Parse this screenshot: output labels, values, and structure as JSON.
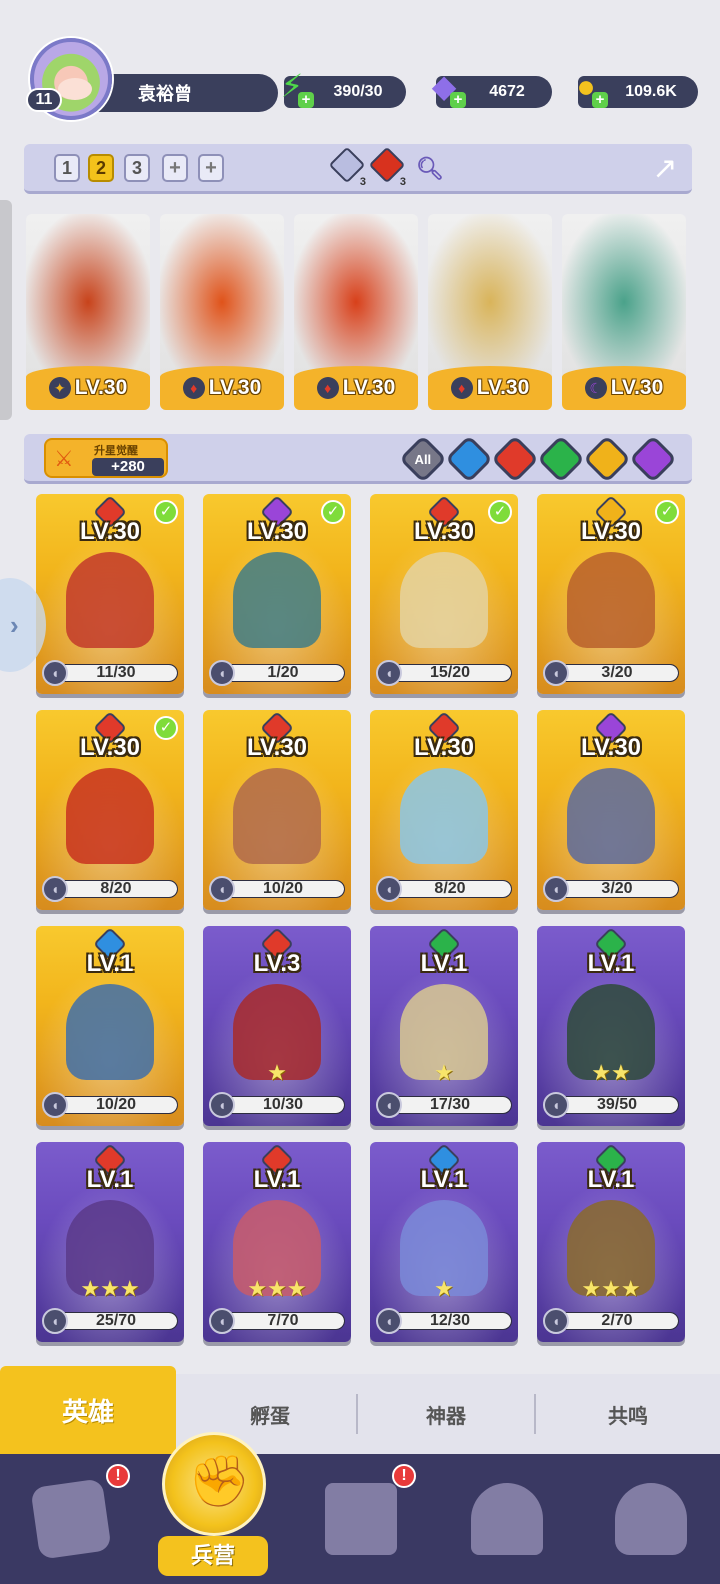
{
  "player": {
    "level": "11",
    "name": "袁裕曾"
  },
  "resources": {
    "energy": "390/30",
    "gems": "4672",
    "gold": "109.6K"
  },
  "team": {
    "tabs": [
      "1",
      "2",
      "3",
      "+",
      "+"
    ],
    "active_tab": "2",
    "crystal_ice_count": "3",
    "crystal_fire_count": "3",
    "heroes": [
      {
        "level": "LV.30",
        "element": "light",
        "color": "#c8431b"
      },
      {
        "level": "LV.30",
        "element": "fire",
        "color": "#e0531a"
      },
      {
        "level": "LV.30",
        "element": "fire",
        "color": "#d8401a"
      },
      {
        "level": "LV.30",
        "element": "fire",
        "color": "#d9b45a"
      },
      {
        "level": "LV.30",
        "element": "dark",
        "color": "#4aa28a"
      }
    ]
  },
  "awaken": {
    "label": "升星觉醒",
    "value": "+280"
  },
  "filters": [
    {
      "label": "All",
      "color": "#777788"
    },
    {
      "label": "",
      "color": "#2f8fe0"
    },
    {
      "label": "",
      "color": "#e03a2a"
    },
    {
      "label": "",
      "color": "#2bb34a"
    },
    {
      "label": "",
      "color": "#f0b21a"
    },
    {
      "label": "",
      "color": "#9a45d8"
    }
  ],
  "heroes": [
    {
      "level": "LV.30",
      "progress": "11/30",
      "fraction": 0.37,
      "frame": "gold",
      "element": "fire",
      "elem_color": "#e03a2a",
      "check": true,
      "stars": "",
      "art": "#c23a2a"
    },
    {
      "level": "LV.30",
      "progress": "1/20",
      "fraction": 0.05,
      "frame": "gold",
      "element": "dark",
      "elem_color": "#9a45d8",
      "check": true,
      "stars": "",
      "art": "#3f7d86"
    },
    {
      "level": "LV.30",
      "progress": "15/20",
      "fraction": 0.75,
      "frame": "gold",
      "element": "fire",
      "elem_color": "#e03a2a",
      "check": true,
      "stars": "",
      "art": "#e4d2a0"
    },
    {
      "level": "LV.30",
      "progress": "3/20",
      "fraction": 0.15,
      "frame": "gold",
      "element": "light",
      "elem_color": "#f0b21a",
      "check": true,
      "stars": "",
      "art": "#b9602c"
    },
    {
      "level": "LV.30",
      "progress": "8/20",
      "fraction": 0.4,
      "frame": "gold",
      "element": "fire",
      "elem_color": "#e03a2a",
      "check": true,
      "stars": "",
      "art": "#c8321e"
    },
    {
      "level": "LV.30",
      "progress": "10/20",
      "fraction": 0.5,
      "frame": "gold",
      "element": "fire",
      "elem_color": "#e03a2a",
      "check": false,
      "stars": "",
      "art": "#b06a4a"
    },
    {
      "level": "LV.30",
      "progress": "8/20",
      "fraction": 0.4,
      "frame": "gold",
      "element": "fire",
      "elem_color": "#e03a2a",
      "check": false,
      "stars": "",
      "art": "#8ac6e8"
    },
    {
      "level": "LV.30",
      "progress": "3/20",
      "fraction": 0.15,
      "frame": "gold",
      "element": "dark",
      "elem_color": "#9a45d8",
      "check": false,
      "stars": "",
      "art": "#5c6a9c"
    },
    {
      "level": "LV.1",
      "progress": "10/20",
      "fraction": 0.5,
      "frame": "gold",
      "element": "water",
      "elem_color": "#2f8fe0",
      "check": false,
      "stars": "",
      "art": "#3f6fa8"
    },
    {
      "level": "LV.3",
      "progress": "10/30",
      "fraction": 0.33,
      "frame": "purple",
      "element": "fire",
      "elem_color": "#e03a2a",
      "check": false,
      "stars": "★",
      "art": "#a82a2a"
    },
    {
      "level": "LV.1",
      "progress": "17/30",
      "fraction": 0.57,
      "frame": "purple",
      "element": "nature",
      "elem_color": "#2bb34a",
      "check": false,
      "stars": "★",
      "art": "#d8c890"
    },
    {
      "level": "LV.1",
      "progress": "39/50",
      "fraction": 0.78,
      "frame": "purple",
      "element": "nature",
      "elem_color": "#2bb34a",
      "check": false,
      "stars": "★★",
      "art": "#2e4a3a"
    },
    {
      "level": "LV.1",
      "progress": "25/70",
      "fraction": 0.36,
      "frame": "purple",
      "element": "fire",
      "elem_color": "#e03a2a",
      "check": false,
      "stars": "★★★",
      "art": "#5a3a8a"
    },
    {
      "level": "LV.1",
      "progress": "7/70",
      "fraction": 0.1,
      "frame": "purple",
      "element": "fire",
      "elem_color": "#e03a2a",
      "check": false,
      "stars": "★★★",
      "art": "#c85a6a"
    },
    {
      "level": "LV.1",
      "progress": "12/30",
      "fraction": 0.4,
      "frame": "purple",
      "element": "water",
      "elem_color": "#2f8fe0",
      "check": false,
      "stars": "★",
      "art": "#7a8ad8"
    },
    {
      "level": "LV.1",
      "progress": "2/70",
      "fraction": 0.03,
      "frame": "purple",
      "element": "nature",
      "elem_color": "#2bb34a",
      "check": false,
      "stars": "★★★",
      "art": "#8a6a2a"
    }
  ],
  "subtabs": [
    "英雄",
    "孵蛋",
    "神器",
    "共鸣"
  ],
  "bottom_nav": {
    "items": [
      {
        "name": "cards",
        "alert": "!"
      },
      {
        "name": "barracks",
        "label": "兵营"
      },
      {
        "name": "book",
        "alert": "!"
      },
      {
        "name": "castle"
      },
      {
        "name": "mushroom"
      }
    ]
  }
}
